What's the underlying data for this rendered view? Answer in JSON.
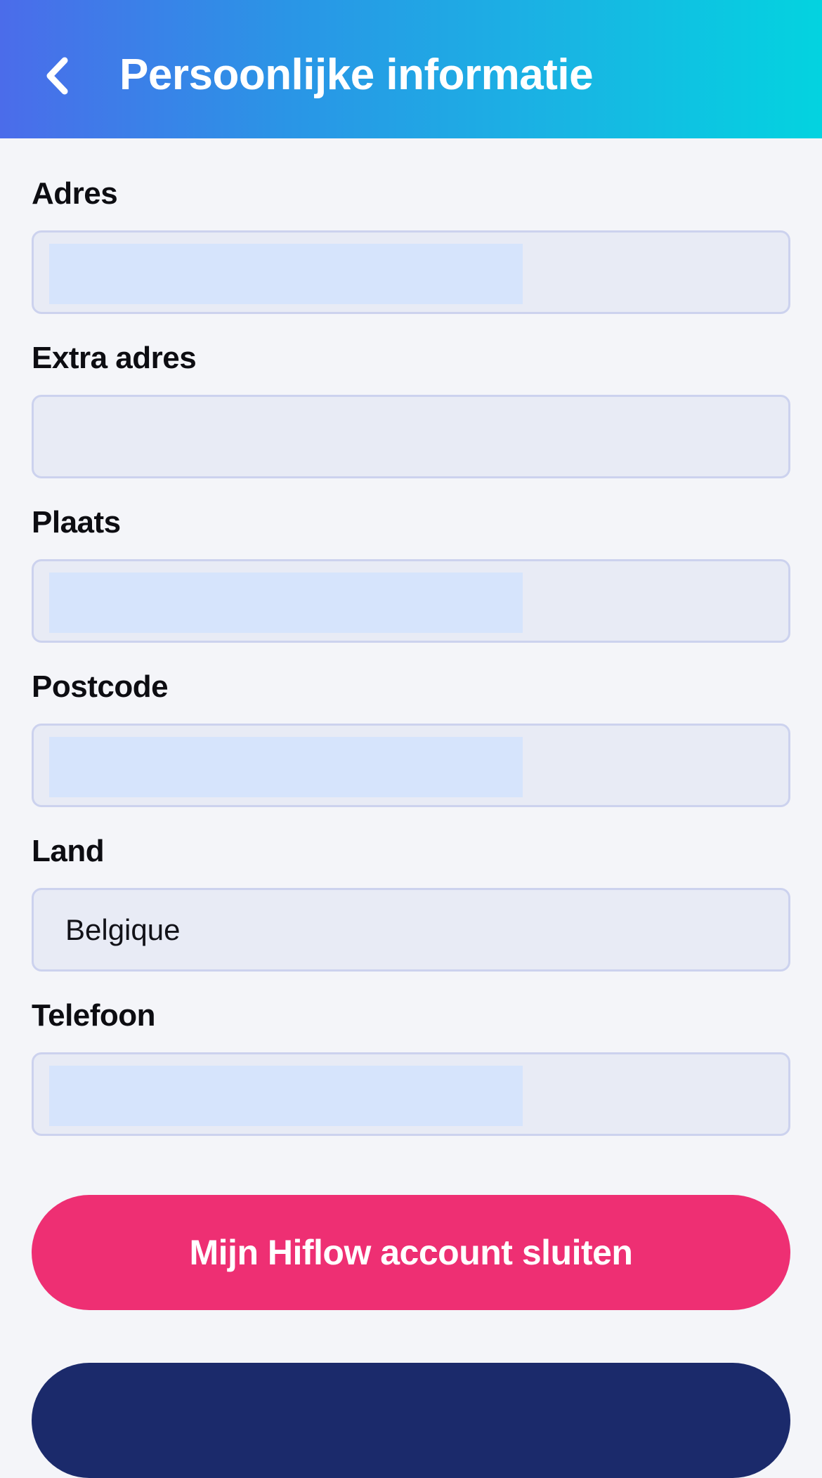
{
  "header": {
    "title": "Persoonlijke informatie",
    "back_icon": "chevron-left-icon",
    "gradient": [
      "#4b6cea",
      "#03d3e0"
    ]
  },
  "form": {
    "fields": [
      {
        "key": "adres",
        "label": "Adres",
        "value": "",
        "redacted": true
      },
      {
        "key": "extra_adres",
        "label": "Extra adres",
        "value": "",
        "redacted": false
      },
      {
        "key": "plaats",
        "label": "Plaats",
        "value": "",
        "redacted": true
      },
      {
        "key": "postcode",
        "label": "Postcode",
        "value": "",
        "redacted": true
      },
      {
        "key": "land",
        "label": "Land",
        "value": "Belgique",
        "redacted": false
      },
      {
        "key": "telefoon",
        "label": "Telefoon",
        "value": "",
        "redacted": true
      }
    ]
  },
  "actions": {
    "close_account_label": "Mijn Hiflow account sluiten",
    "close_account_color": "#ee2f73"
  },
  "colors": {
    "background": "#f4f5f9",
    "field_background": "#e8ebf5",
    "field_border": "#ccd2ee",
    "secondary_button": "#1b2a6b"
  }
}
